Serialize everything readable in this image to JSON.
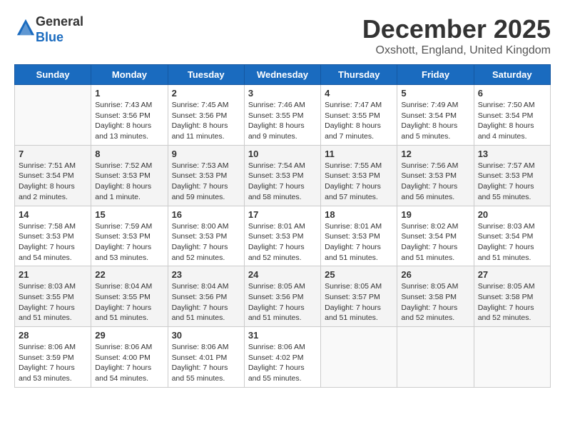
{
  "header": {
    "logo_line1": "General",
    "logo_line2": "Blue",
    "month_year": "December 2025",
    "location": "Oxshott, England, United Kingdom"
  },
  "weekdays": [
    "Sunday",
    "Monday",
    "Tuesday",
    "Wednesday",
    "Thursday",
    "Friday",
    "Saturday"
  ],
  "weeks": [
    [
      {
        "day": "",
        "info": ""
      },
      {
        "day": "1",
        "info": "Sunrise: 7:43 AM\nSunset: 3:56 PM\nDaylight: 8 hours\nand 13 minutes."
      },
      {
        "day": "2",
        "info": "Sunrise: 7:45 AM\nSunset: 3:56 PM\nDaylight: 8 hours\nand 11 minutes."
      },
      {
        "day": "3",
        "info": "Sunrise: 7:46 AM\nSunset: 3:55 PM\nDaylight: 8 hours\nand 9 minutes."
      },
      {
        "day": "4",
        "info": "Sunrise: 7:47 AM\nSunset: 3:55 PM\nDaylight: 8 hours\nand 7 minutes."
      },
      {
        "day": "5",
        "info": "Sunrise: 7:49 AM\nSunset: 3:54 PM\nDaylight: 8 hours\nand 5 minutes."
      },
      {
        "day": "6",
        "info": "Sunrise: 7:50 AM\nSunset: 3:54 PM\nDaylight: 8 hours\nand 4 minutes."
      }
    ],
    [
      {
        "day": "7",
        "info": "Sunrise: 7:51 AM\nSunset: 3:54 PM\nDaylight: 8 hours\nand 2 minutes."
      },
      {
        "day": "8",
        "info": "Sunrise: 7:52 AM\nSunset: 3:53 PM\nDaylight: 8 hours\nand 1 minute."
      },
      {
        "day": "9",
        "info": "Sunrise: 7:53 AM\nSunset: 3:53 PM\nDaylight: 7 hours\nand 59 minutes."
      },
      {
        "day": "10",
        "info": "Sunrise: 7:54 AM\nSunset: 3:53 PM\nDaylight: 7 hours\nand 58 minutes."
      },
      {
        "day": "11",
        "info": "Sunrise: 7:55 AM\nSunset: 3:53 PM\nDaylight: 7 hours\nand 57 minutes."
      },
      {
        "day": "12",
        "info": "Sunrise: 7:56 AM\nSunset: 3:53 PM\nDaylight: 7 hours\nand 56 minutes."
      },
      {
        "day": "13",
        "info": "Sunrise: 7:57 AM\nSunset: 3:53 PM\nDaylight: 7 hours\nand 55 minutes."
      }
    ],
    [
      {
        "day": "14",
        "info": "Sunrise: 7:58 AM\nSunset: 3:53 PM\nDaylight: 7 hours\nand 54 minutes."
      },
      {
        "day": "15",
        "info": "Sunrise: 7:59 AM\nSunset: 3:53 PM\nDaylight: 7 hours\nand 53 minutes."
      },
      {
        "day": "16",
        "info": "Sunrise: 8:00 AM\nSunset: 3:53 PM\nDaylight: 7 hours\nand 52 minutes."
      },
      {
        "day": "17",
        "info": "Sunrise: 8:01 AM\nSunset: 3:53 PM\nDaylight: 7 hours\nand 52 minutes."
      },
      {
        "day": "18",
        "info": "Sunrise: 8:01 AM\nSunset: 3:53 PM\nDaylight: 7 hours\nand 51 minutes."
      },
      {
        "day": "19",
        "info": "Sunrise: 8:02 AM\nSunset: 3:54 PM\nDaylight: 7 hours\nand 51 minutes."
      },
      {
        "day": "20",
        "info": "Sunrise: 8:03 AM\nSunset: 3:54 PM\nDaylight: 7 hours\nand 51 minutes."
      }
    ],
    [
      {
        "day": "21",
        "info": "Sunrise: 8:03 AM\nSunset: 3:55 PM\nDaylight: 7 hours\nand 51 minutes."
      },
      {
        "day": "22",
        "info": "Sunrise: 8:04 AM\nSunset: 3:55 PM\nDaylight: 7 hours\nand 51 minutes."
      },
      {
        "day": "23",
        "info": "Sunrise: 8:04 AM\nSunset: 3:56 PM\nDaylight: 7 hours\nand 51 minutes."
      },
      {
        "day": "24",
        "info": "Sunrise: 8:05 AM\nSunset: 3:56 PM\nDaylight: 7 hours\nand 51 minutes."
      },
      {
        "day": "25",
        "info": "Sunrise: 8:05 AM\nSunset: 3:57 PM\nDaylight: 7 hours\nand 51 minutes."
      },
      {
        "day": "26",
        "info": "Sunrise: 8:05 AM\nSunset: 3:58 PM\nDaylight: 7 hours\nand 52 minutes."
      },
      {
        "day": "27",
        "info": "Sunrise: 8:05 AM\nSunset: 3:58 PM\nDaylight: 7 hours\nand 52 minutes."
      }
    ],
    [
      {
        "day": "28",
        "info": "Sunrise: 8:06 AM\nSunset: 3:59 PM\nDaylight: 7 hours\nand 53 minutes."
      },
      {
        "day": "29",
        "info": "Sunrise: 8:06 AM\nSunset: 4:00 PM\nDaylight: 7 hours\nand 54 minutes."
      },
      {
        "day": "30",
        "info": "Sunrise: 8:06 AM\nSunset: 4:01 PM\nDaylight: 7 hours\nand 55 minutes."
      },
      {
        "day": "31",
        "info": "Sunrise: 8:06 AM\nSunset: 4:02 PM\nDaylight: 7 hours\nand 55 minutes."
      },
      {
        "day": "",
        "info": ""
      },
      {
        "day": "",
        "info": ""
      },
      {
        "day": "",
        "info": ""
      }
    ]
  ]
}
